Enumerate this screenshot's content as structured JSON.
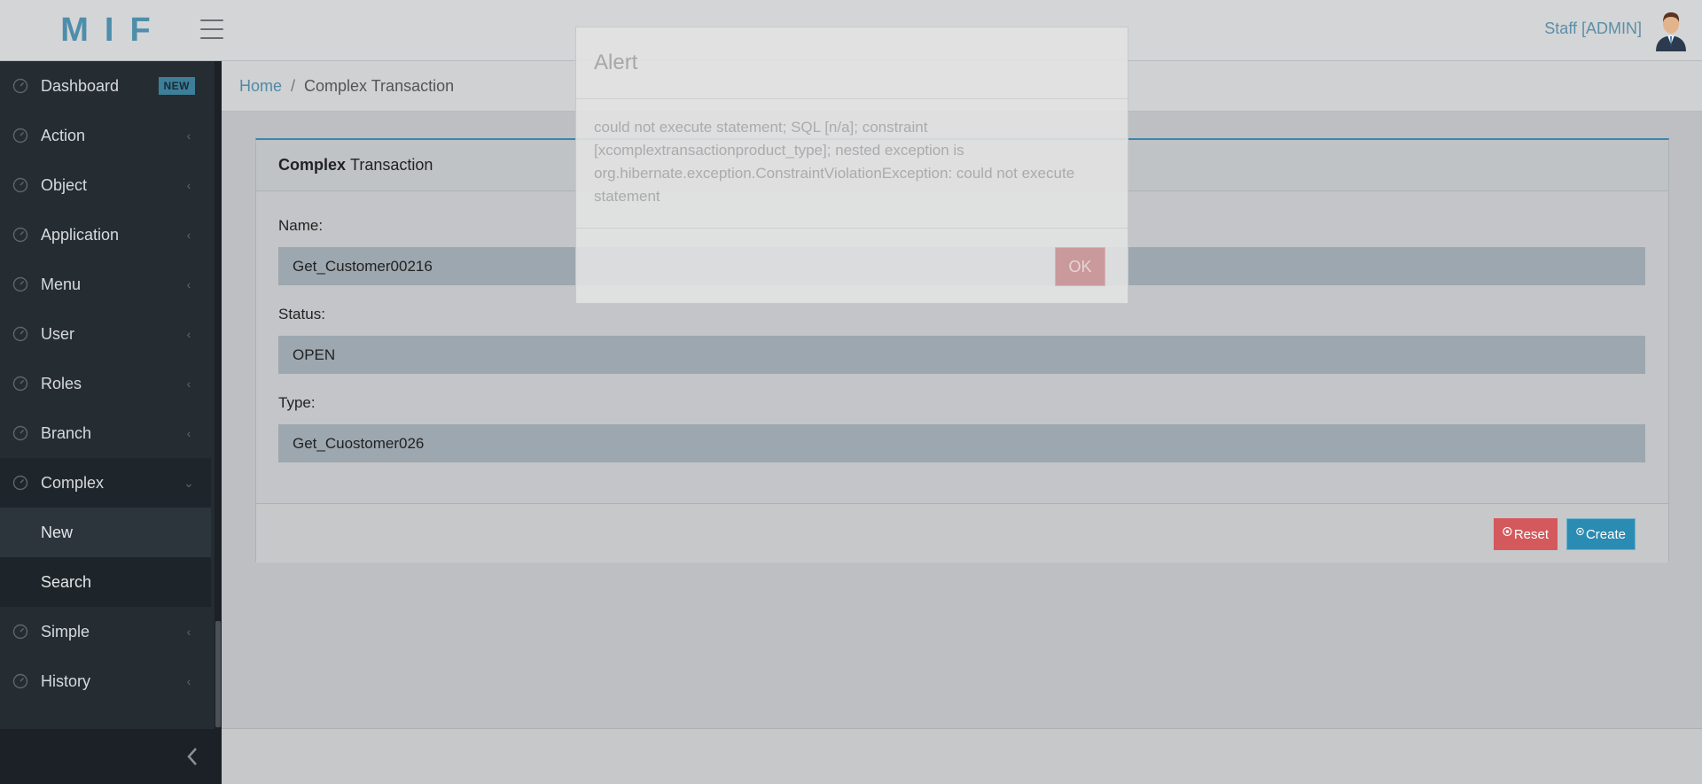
{
  "header": {
    "logo": "MIF",
    "user_label": "Staff [ADMIN]"
  },
  "sidebar": {
    "items": [
      {
        "label": "Dashboard",
        "badge": "NEW"
      },
      {
        "label": "Action"
      },
      {
        "label": "Object"
      },
      {
        "label": "Application"
      },
      {
        "label": "Menu"
      },
      {
        "label": "User"
      },
      {
        "label": "Roles"
      },
      {
        "label": "Branch"
      },
      {
        "label": "Complex",
        "expanded": true
      },
      {
        "label": "Simple"
      },
      {
        "label": "History"
      }
    ],
    "sub_items": [
      {
        "label": "New",
        "active": true
      },
      {
        "label": "Search"
      }
    ]
  },
  "breadcrumb": {
    "home": "Home",
    "separator": "/",
    "current": "Complex Transaction"
  },
  "panel": {
    "title_bold": "Complex",
    "title_rest": "Transaction",
    "fields": [
      {
        "label": "Name:",
        "value": "Get_Customer00216"
      },
      {
        "label": "Status:",
        "value": "OPEN"
      },
      {
        "label": "Type:",
        "value": "Get_Cuostomer026"
      }
    ],
    "reset_label": "Reset",
    "create_label": "Create"
  },
  "alert": {
    "title": "Alert",
    "message": "could not execute statement; SQL [n/a]; constraint [xcomplextransactionproduct_type]; nested exception is org.hibernate.exception.ConstraintViolationException: could not execute statement",
    "ok_label": "OK"
  },
  "colors": {
    "accent": "#3a87a8",
    "sidebar_bg": "#252d33",
    "reset": "#d4595c",
    "create": "#2a8bb3"
  }
}
